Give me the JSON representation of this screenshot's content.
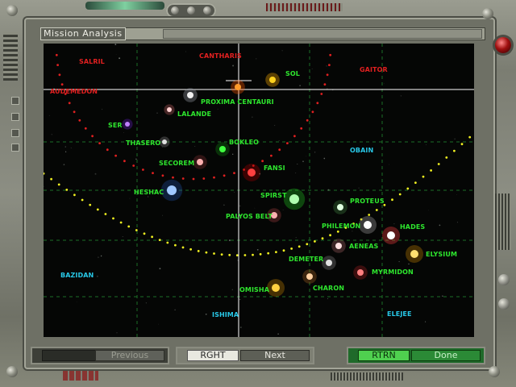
{
  "window": {
    "title": "Mission Analysis"
  },
  "colors": {
    "label_green": "#2ee62e",
    "label_red": "#e22020",
    "label_cyan": "#28c8e8",
    "grid_green": "#1f7a2a",
    "crosshair": "#ffffff",
    "arc_red": "#e02020",
    "arc_yellow": "#f0f020"
  },
  "map": {
    "labels": [
      {
        "text": "SALRIL",
        "color": "red"
      },
      {
        "text": "CANTHARIS",
        "color": "red"
      },
      {
        "text": "SOL",
        "color": "green"
      },
      {
        "text": "GAITOR",
        "color": "red"
      },
      {
        "text": "AUDEMEDON",
        "color": "red"
      },
      {
        "text": "PROXIMA CENTAURI",
        "color": "green"
      },
      {
        "text": "LALANDE",
        "color": "green"
      },
      {
        "text": "SER",
        "color": "green"
      },
      {
        "text": "THASERO",
        "color": "green"
      },
      {
        "text": "BOKLEO",
        "color": "green"
      },
      {
        "text": "OBAIN",
        "color": "cyan"
      },
      {
        "text": "SECOREM",
        "color": "green"
      },
      {
        "text": "FANSI",
        "color": "green"
      },
      {
        "text": "HESHAC",
        "color": "green"
      },
      {
        "text": "SPIRST",
        "color": "green"
      },
      {
        "text": "PROTEUS",
        "color": "green"
      },
      {
        "text": "PALYOS BELT",
        "color": "green"
      },
      {
        "text": "PHILEMON",
        "color": "green"
      },
      {
        "text": "HADES",
        "color": "green"
      },
      {
        "text": "AENEAS",
        "color": "green"
      },
      {
        "text": "ELYSIUM",
        "color": "green"
      },
      {
        "text": "DEMETER",
        "color": "green"
      },
      {
        "text": "BAZIDAN",
        "color": "cyan"
      },
      {
        "text": "MYRMIDON",
        "color": "green"
      },
      {
        "text": "CHARON",
        "color": "green"
      },
      {
        "text": "OMISHA",
        "color": "green"
      },
      {
        "text": "ISHIMA",
        "color": "cyan"
      },
      {
        "text": "ELEJEE",
        "color": "cyan"
      }
    ],
    "stars": [
      {
        "name": "sol",
        "color": "#ffd21e",
        "glow": "#ffb000"
      },
      {
        "name": "cantharis",
        "color": "#ff9a2a",
        "glow": "#ff5a00"
      },
      {
        "name": "proxima-centauri",
        "color": "#f0f0f0",
        "glow": "#9aa0aa"
      },
      {
        "name": "lalande",
        "color": "#ffd0d0",
        "glow": "#c06060"
      },
      {
        "name": "ser",
        "color": "#c080ff",
        "glow": "#6020c0"
      },
      {
        "name": "thasero",
        "color": "#e0e0e0",
        "glow": "#808080"
      },
      {
        "name": "bokleo",
        "color": "#40ff40",
        "glow": "#108010"
      },
      {
        "name": "secorem",
        "color": "#ffb0b0",
        "glow": "#803030"
      },
      {
        "name": "fansi",
        "color": "#ff4040",
        "glow": "#a00000"
      },
      {
        "name": "heshac",
        "color": "#a0c8ff",
        "glow": "#2050a0"
      },
      {
        "name": "spirst",
        "color": "#b0ffb0",
        "glow": "#20c020"
      },
      {
        "name": "proteus",
        "color": "#e0ffe0",
        "glow": "#408040"
      },
      {
        "name": "palyos-belt",
        "color": "#ffb0b0",
        "glow": "#a04040"
      },
      {
        "name": "philemon",
        "color": "#ffffff",
        "glow": "#a0a0a0"
      },
      {
        "name": "hades",
        "color": "#ffffff",
        "glow": "#ff4040"
      },
      {
        "name": "aeneas",
        "color": "#ffe0e0",
        "glow": "#a06060"
      },
      {
        "name": "elysium",
        "color": "#ffe070",
        "glow": "#c08000"
      },
      {
        "name": "demeter",
        "color": "#e0e0e0",
        "glow": "#808080"
      },
      {
        "name": "myrmidon",
        "color": "#ff8080",
        "glow": "#a02020"
      },
      {
        "name": "charon",
        "color": "#ffd0a0",
        "glow": "#a06020"
      },
      {
        "name": "omisha",
        "color": "#ffd040",
        "glow": "#c08000"
      }
    ]
  },
  "buttons": {
    "previous": "Previous",
    "rght": "RGHT",
    "next": "Next",
    "rtrn": "RTRN",
    "done": "Done"
  }
}
